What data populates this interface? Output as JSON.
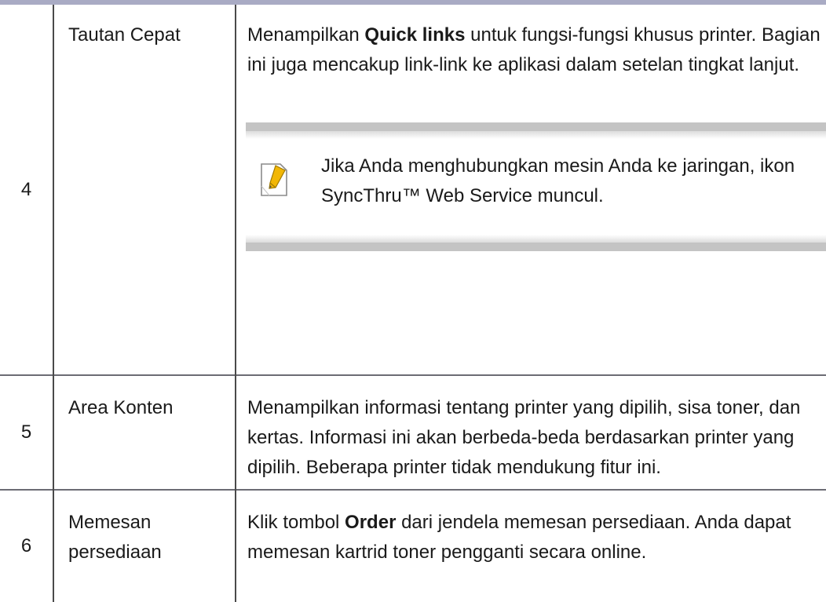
{
  "rows": [
    {
      "num": "4",
      "name": "Tautan Cepat",
      "desc_parts": [
        "Menampilkan ",
        "Quick links",
        " untuk fungsi-fungsi khusus printer. Bagian ini juga mencakup link-link ke aplikasi dalam setelan tingkat lanjut."
      ],
      "note": {
        "icon": "note-pencil-icon",
        "text": "Jika Anda menghubungkan mesin Anda ke jaringan, ikon SyncThru™ Web Service muncul."
      }
    },
    {
      "num": "5",
      "name": "Area Konten",
      "desc": "Menampilkan informasi tentang printer yang dipilih, sisa toner, dan kertas. Informasi ini akan berbeda-beda berdasarkan printer yang dipilih. Beberapa printer tidak mendukung fitur ini."
    },
    {
      "num": "6",
      "name": "Memesan persediaan",
      "desc_parts": [
        "Klik tombol ",
        "Order",
        " dari jendela memesan persediaan. Anda dapat memesan kartrid toner pengganti secara online."
      ]
    }
  ],
  "colors": {
    "top_rule": "#a9abc4",
    "note_band": "#c4c4c4",
    "icon_accent": "#f2b705"
  }
}
